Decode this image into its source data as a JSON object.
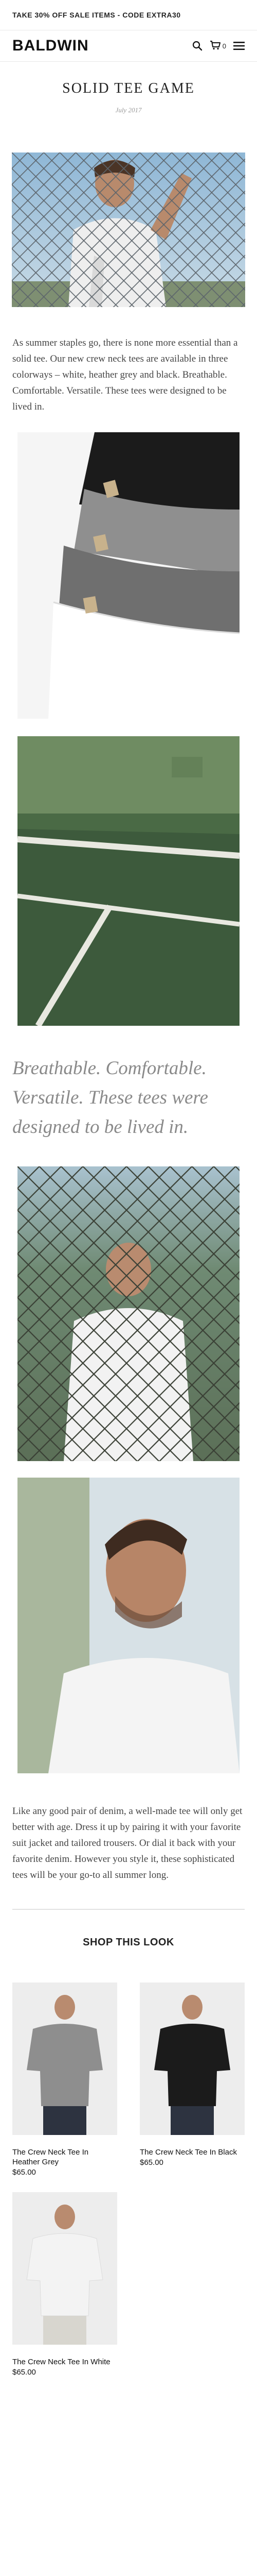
{
  "promo": {
    "text": "TAKE 30% OFF SALE ITEMS - CODE EXTRA30"
  },
  "header": {
    "logo": "BALDWIN",
    "cart_count": "0"
  },
  "article": {
    "title": "SOLID TEE GAME",
    "date": "July 2017",
    "intro": "As summer staples go, there is none more essential than a solid tee. Our new crew neck tees are available in three colorways – white, heather grey and black. Breathable. Comfortable. Versatile. These tees were designed to be lived in.",
    "pull_quote": "Breathable. Comfortable. Versatile. These tees were designed to be lived in.",
    "body": "Like any good pair of denim, a well-made tee will only get better with age. Dress it up by pairing it with your favorite suit jacket and tailored trousers. Or dial it back with your favorite denim. However you style it, these sophisticated tees will be your go-to all summer long."
  },
  "shop": {
    "heading": "SHOP THIS LOOK",
    "products": [
      {
        "name": "The Crew Neck Tee In Heather Grey",
        "price": "$65.00",
        "tee_color": "#8e8e8e"
      },
      {
        "name": "The Crew Neck Tee In Black",
        "price": "$65.00",
        "tee_color": "#1b1b1b"
      },
      {
        "name": "The Crew Neck Tee In White",
        "price": "$65.00",
        "tee_color": "#f3f3f3"
      }
    ]
  }
}
